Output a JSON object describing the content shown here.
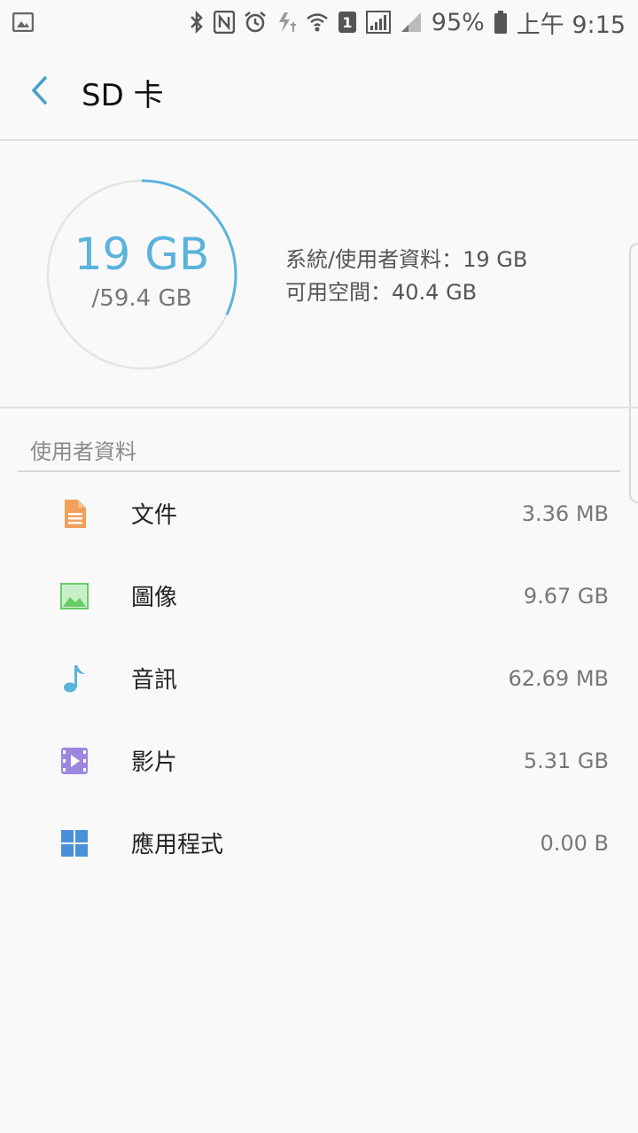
{
  "status_bar": {
    "battery_percent": "95%",
    "time": "上午 9:15",
    "sim_slot": "1",
    "icons": [
      "gallery-notification-icon",
      "bluetooth-icon",
      "nfc-icon",
      "alarm-icon",
      "data-saver-icon",
      "wifi-icon",
      "sim-1-icon",
      "signal-icon",
      "signal-weak-icon",
      "battery-icon"
    ]
  },
  "header": {
    "title": "SD 卡"
  },
  "summary": {
    "used": "19 GB",
    "total": "/59.4 GB",
    "used_fraction": 0.32,
    "system_user_line": "系統/使用者資料：19 GB",
    "available_line": "可用空間：40.4 GB",
    "ring_color": "#5ab3db"
  },
  "section": {
    "title": "使用者資料"
  },
  "items": [
    {
      "label": "文件",
      "size": "3.36 MB",
      "icon": "document-icon",
      "color": "#f0a05a"
    },
    {
      "label": "圖像",
      "size": "9.67 GB",
      "icon": "image-icon",
      "color": "#66cc66"
    },
    {
      "label": "音訊",
      "size": "62.69 MB",
      "icon": "music-note-icon",
      "color": "#5ab3db"
    },
    {
      "label": "影片",
      "size": "5.31 GB",
      "icon": "video-icon",
      "color": "#9b87e0"
    },
    {
      "label": "應用程式",
      "size": "0.00 B",
      "icon": "apps-grid-icon",
      "color": "#4a90d9"
    }
  ]
}
